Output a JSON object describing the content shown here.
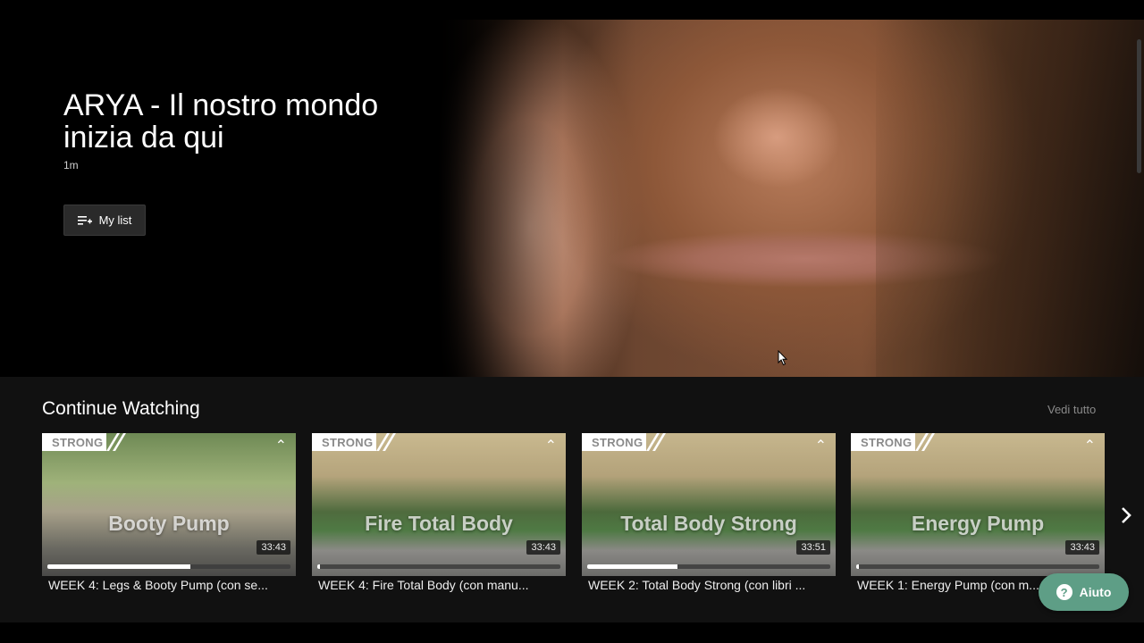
{
  "hero": {
    "title": "ARYA - Il nostro mondo inizia da qui",
    "duration": "1m",
    "mylist_label": "My list"
  },
  "continue_watching": {
    "title": "Continue Watching",
    "see_all": "Vedi tutto",
    "cards": [
      {
        "tag": "STRONG",
        "thumb_title": "Booty Pump",
        "duration": "33:43",
        "progress": 0.59,
        "caption": "WEEK 4: Legs & Booty Pump (con se..."
      },
      {
        "tag": "STRONG",
        "thumb_title": "Fire Total Body",
        "duration": "33:43",
        "progress": 0.01,
        "caption": "WEEK 4: Fire Total Body (con manu..."
      },
      {
        "tag": "STRONG",
        "thumb_title": "Total Body Strong",
        "duration": "33:51",
        "progress": 0.37,
        "caption": "WEEK 2: Total Body Strong (con libri ..."
      },
      {
        "tag": "STRONG",
        "thumb_title": "Energy Pump",
        "duration": "33:43",
        "progress": 0.01,
        "caption": "WEEK 1: Energy Pump (con m..."
      }
    ]
  },
  "help": {
    "label": "Aiuto",
    "icon": "?"
  },
  "colors": {
    "accent": "#5e9e86",
    "background": "#000000",
    "panel": "#111111"
  }
}
